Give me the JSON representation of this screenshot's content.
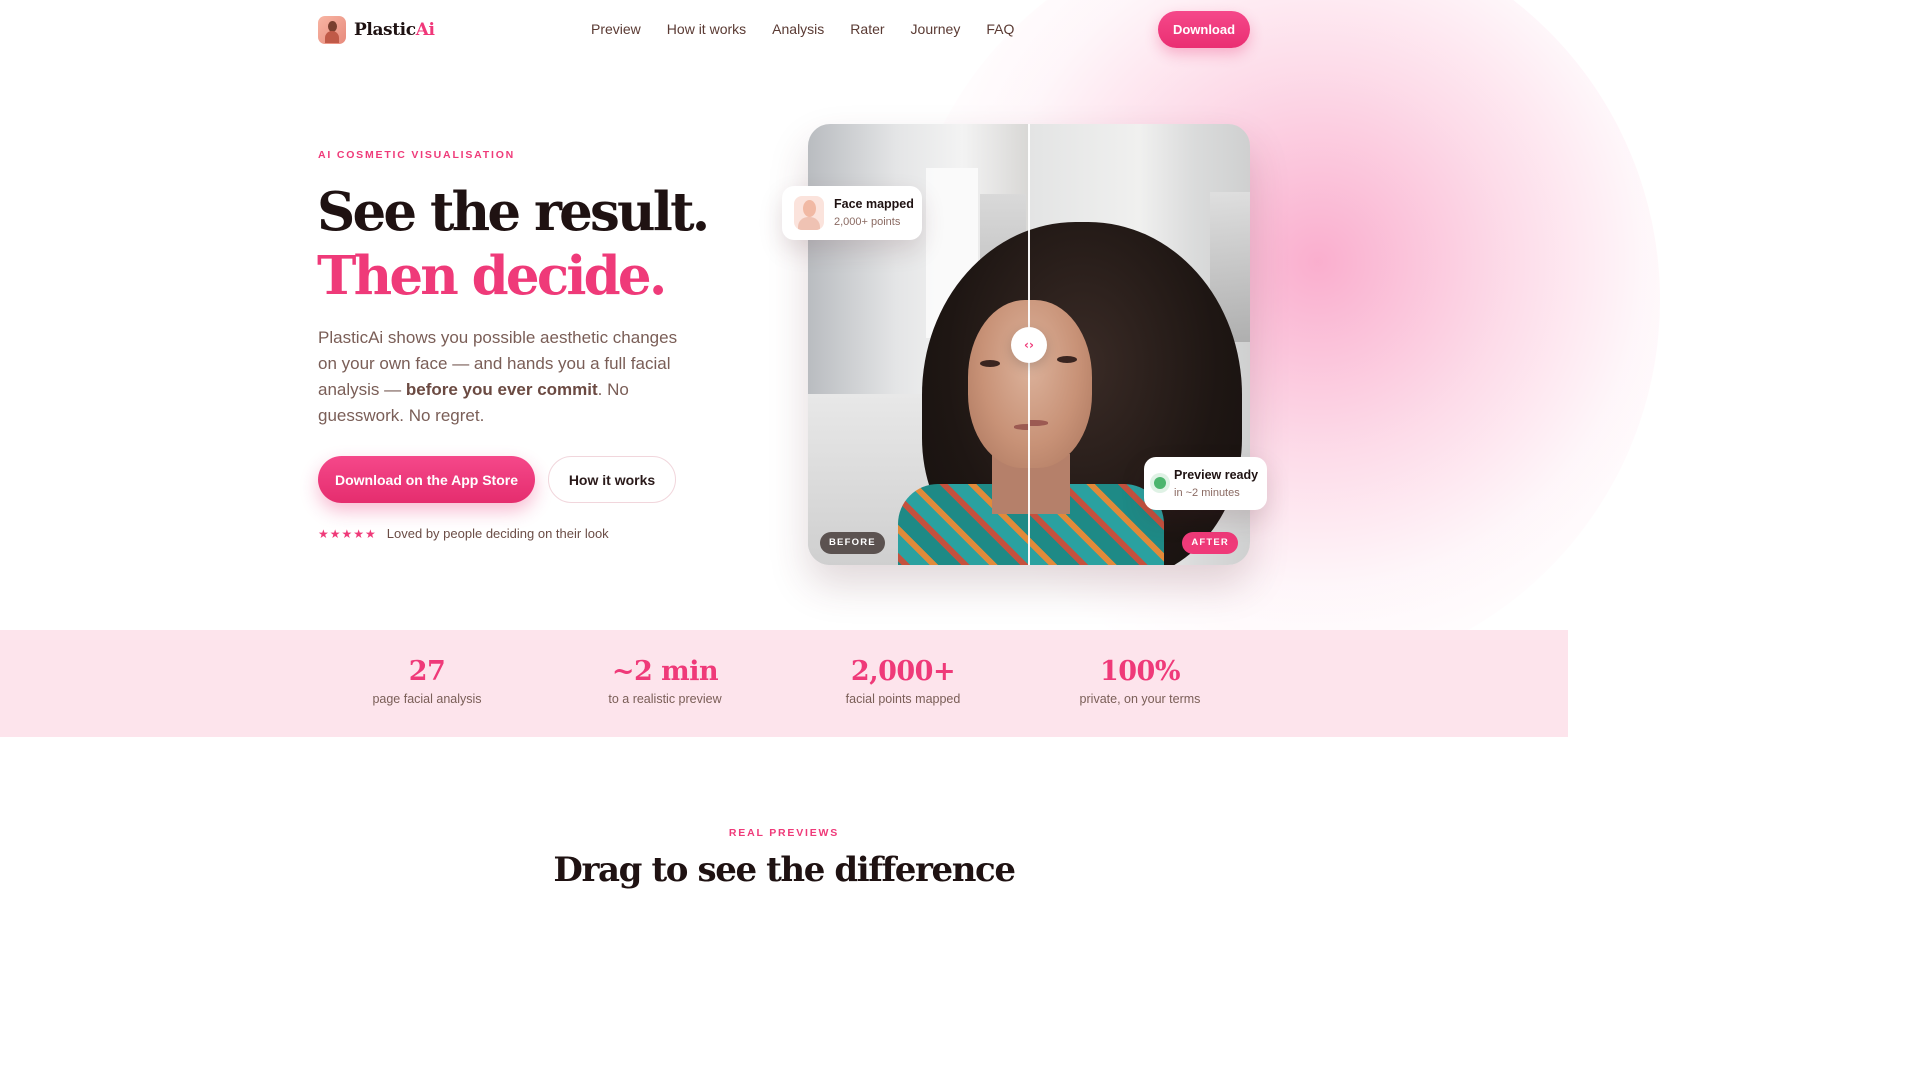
{
  "brand": {
    "name_part1": "Plastic",
    "name_part2": "Ai"
  },
  "nav": {
    "links": [
      "Preview",
      "How it works",
      "Analysis",
      "Rater",
      "Journey",
      "FAQ"
    ],
    "download_label": "Download"
  },
  "hero": {
    "eyebrow": "AI COSMETIC VISUALISATION",
    "headline_line1": "See the result.",
    "headline_line2": "Then decide.",
    "lead_part1": "PlasticAi shows you possible aesthetic changes on your own face — and hands you a full facial analysis — ",
    "lead_bold": "before you ever commit",
    "lead_part2": ". No guesswork. No regret.",
    "primary_cta": "Download on the App Store",
    "secondary_cta": "How it works",
    "stars": "★★★★★",
    "rating_text": "Loved by people deciding on their look"
  },
  "comparison": {
    "before_label": "BEFORE",
    "after_label": "AFTER",
    "handle_glyph": "‹›",
    "mapped_title": "Face mapped",
    "mapped_sub": "2,000+ points",
    "ready_title": "Preview ready",
    "ready_sub": "in ~2 minutes"
  },
  "stats": [
    {
      "value": "27",
      "label": "page facial analysis"
    },
    {
      "value": "~2 min",
      "label": "to a realistic preview"
    },
    {
      "value": "2,000+",
      "label": "facial points mapped"
    },
    {
      "value": "100%",
      "label": "private, on your terms"
    }
  ],
  "section2": {
    "eyebrow": "REAL PREVIEWS",
    "title": "Drag to see the difference"
  },
  "colors": {
    "accent": "#ef3a79",
    "ink": "#1f1212",
    "stats_bg": "#fde4ec",
    "ready_dot": "#4cb56e"
  }
}
